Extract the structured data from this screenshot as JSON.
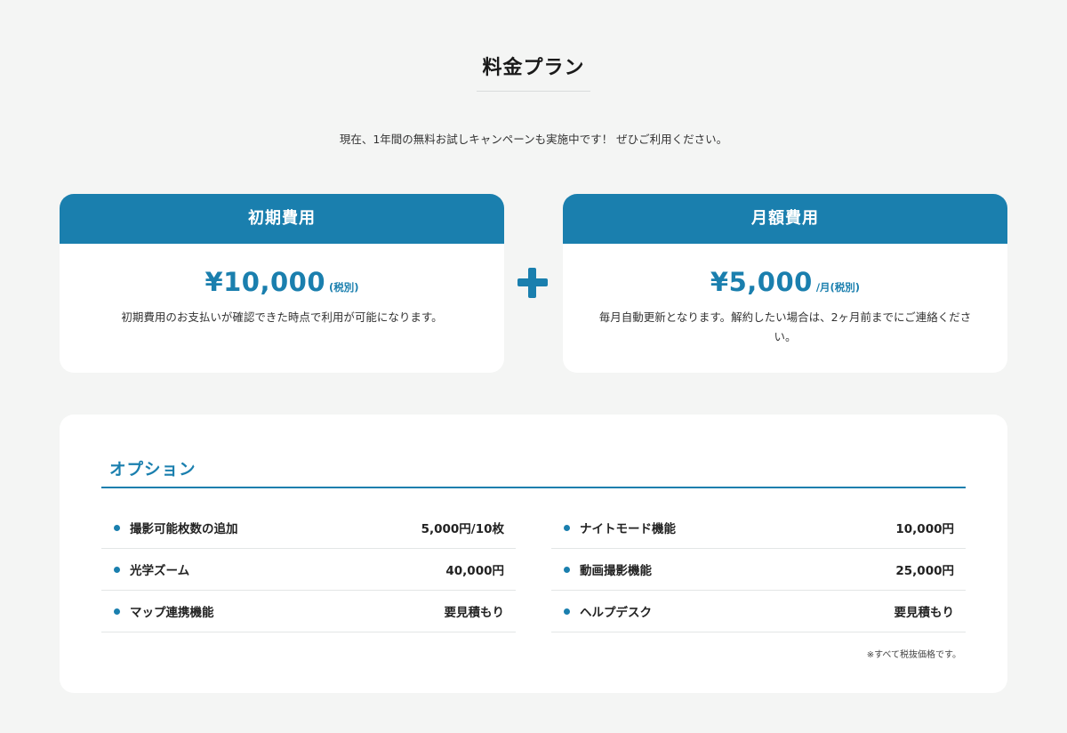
{
  "title": "料金プラン",
  "lead": "現在、1年間の無料お試しキャンペーンも実施中です！ ぜひご利用ください。",
  "initial_fee": {
    "heading": "初期費用",
    "amount": "¥10,000",
    "unit": "(税別)",
    "description": "初期費用のお支払いが確認できた時点で利用が可能になります。"
  },
  "monthly_fee": {
    "heading": "月額費用",
    "amount": "¥5,000",
    "unit": "/月(税別)",
    "description": "毎月自動更新となります。解約したい場合は、2ヶ月前までにご連絡ください。"
  },
  "plus_icon": "plus-icon",
  "options": {
    "heading": "オプション",
    "left": [
      {
        "name": "撮影可能枚数の追加",
        "price": "5,000円/10枚"
      },
      {
        "name": "光学ズーム",
        "price": "40,000円"
      },
      {
        "name": "マップ連携機能",
        "price": "要見積もり"
      }
    ],
    "right": [
      {
        "name": "ナイトモード機能",
        "price": "10,000円"
      },
      {
        "name": "動画撮影機能",
        "price": "25,000円"
      },
      {
        "name": "ヘルプデスク",
        "price": "要見積もり"
      }
    ],
    "note": "※すべて税抜価格です。"
  },
  "colors": {
    "accent": "#1a7fae",
    "background": "#f4f5f4",
    "card": "#ffffff"
  }
}
